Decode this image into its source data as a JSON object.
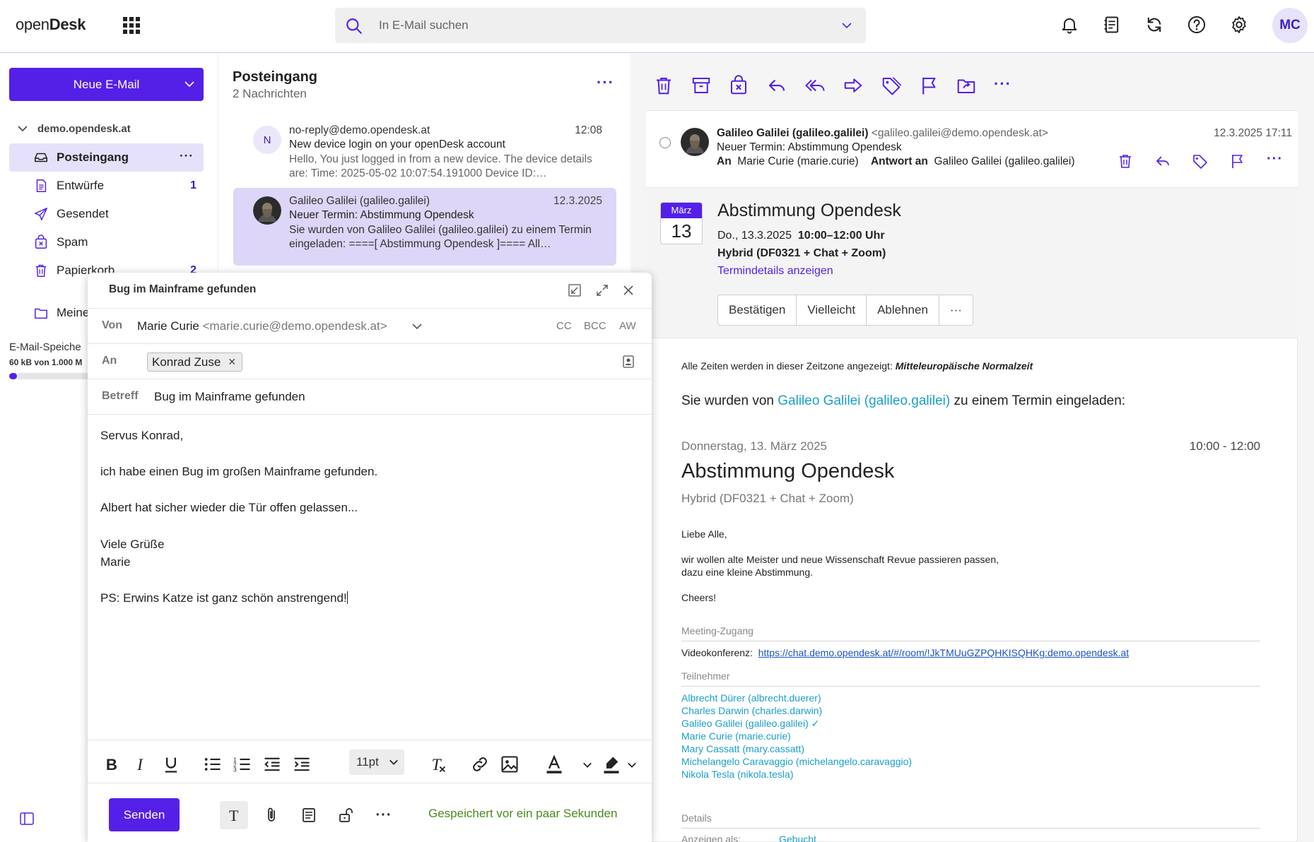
{
  "app": {
    "logo_light": "open",
    "logo_bold": "Desk",
    "avatar_initials": "MC",
    "accent": "#5420e8"
  },
  "search": {
    "placeholder": "In E-Mail suchen"
  },
  "sidebar": {
    "new_mail_label": "Neue E-Mail",
    "account": "demo.opendesk.at",
    "folders": [
      {
        "label": "Posteingang",
        "count": "",
        "icon": "inbox-icon"
      },
      {
        "label": "Entwürfe",
        "count": "1",
        "icon": "draft-icon"
      },
      {
        "label": "Gesendet",
        "count": "",
        "icon": "send-icon"
      },
      {
        "label": "Spam",
        "count": "",
        "icon": "spam-icon"
      },
      {
        "label": "Papierkorb",
        "count": "2",
        "icon": "trash-icon"
      },
      {
        "label": "Meine",
        "count": "",
        "icon": "folder-icon"
      }
    ],
    "storage_label": "E-Mail-Speiche",
    "storage_value": "60 kB von 1.000 M",
    "storage_used_percent": 4
  },
  "list": {
    "title": "Posteingang",
    "count": "2 Nachrichten",
    "messages": [
      {
        "avatar": "N",
        "from": "no-reply@demo.opendesk.at",
        "time": "12:08",
        "subject": "New device login on your openDesk account",
        "preview": "Hello, You just logged in from a new device. The device details are: Time: 2025-05-02 10:07:54.191000 Device ID:…"
      },
      {
        "avatar": "",
        "from": "Galileo Galilei (galileo.galilei)",
        "time": "12.3.2025",
        "subject": "Neuer Termin: Abstimmung Opendesk",
        "preview": "Sie wurden von Galileo Galilei (galileo.galilei) zu einem Termin eingeladen: ====[ Abstimmung Opendesk ]==== All…"
      }
    ]
  },
  "mail": {
    "from_name": "Galileo Galilei (galileo.galilei)",
    "from_email": "<galileo.galilei@demo.opendesk.at>",
    "date": "12.3.2025 17:11",
    "subject": "Neuer Termin: Abstimmung Opendesk",
    "to_label": "An",
    "to_value": "Marie Curie (marie.curie)",
    "reply_to_label": "Antwort an",
    "reply_to_value": "Galileo Galilei (galileo.galilei)"
  },
  "invite": {
    "month": "März",
    "day": "13",
    "title": "Abstimmung Opendesk",
    "date_prefix": "Do., 13.3.2025",
    "time": "10:00–12:00 Uhr",
    "location": "Hybrid (DF0321 + Chat + Zoom)",
    "details_link": "Termindetails anzeigen",
    "rsvp": [
      "Bestätigen",
      "Vielleicht",
      "Ablehnen",
      "···"
    ]
  },
  "body": {
    "timezone_prefix": "Alle Zeiten werden in dieser Zeitzone angezeigt: ",
    "timezone_value": "Mitteleuropäische Normalzeit",
    "invited_prefix": "Sie wurden von ",
    "invited_link": "Galileo Galilei (galileo.galilei)",
    "invited_suffix": " zu einem Termin eingeladen:",
    "event_date": "Donnerstag, 13. März 2025",
    "event_time": "10:00 - 12:00",
    "event_title": "Abstimmung Opendesk",
    "event_location": "Hybrid (DF0321 + Chat + Zoom)",
    "greeting": "Liebe Alle,",
    "line1": "wir wollen alte Meister und neue Wissenschaft Revue passieren passen,",
    "line2": "dazu eine kleine Abstimmung.",
    "closing": "Cheers!",
    "meeting_heading": "Meeting-Zugang",
    "video_label": "Videokonferenz:",
    "video_link": "https://chat.demo.opendesk.at/#/room/!JkTMUuGZPQHKISQHKg:demo.opendesk.at",
    "participants_heading": "Teilnehmer",
    "participants": [
      "Albrecht Dürer (albrecht.duerer)",
      "Charles Darwin (charles.darwin)",
      "Galileo Galilei (galileo.galilei) ✓",
      "Marie Curie (marie.curie)",
      "Mary Cassatt (mary.cassatt)",
      "Michelangelo Caravaggio (michelangelo.caravaggio)",
      "Nikola Tesla (nikola.tesla)"
    ],
    "details_heading": "Details",
    "show_as_label": "Anzeigen als:",
    "show_as_value": "Gebucht"
  },
  "compose": {
    "title": "Bug im Mainframe gefunden",
    "from_label": "Von",
    "from_name": "Marie Curie",
    "from_email": "<marie.curie@demo.opendesk.at>",
    "cc": "CC",
    "bcc": "BCC",
    "aw": "AW",
    "to_label": "An",
    "to_recipient": "Konrad Zuse",
    "subject_label": "Betreff",
    "subject_value": "Bug im Mainframe gefunden",
    "body_lines": [
      "Servus Konrad,",
      "",
      "ich habe einen Bug im großen Mainframe gefunden.",
      "",
      "Albert hat sicher wieder die Tür offen gelassen...",
      "",
      "Viele Grüße",
      "Marie",
      "",
      "PS: Erwins Katze ist ganz schön anstrengend!"
    ],
    "font_size": "11pt",
    "send_label": "Senden",
    "saved_status": "Gespeichert vor ein paar Sekunden"
  }
}
